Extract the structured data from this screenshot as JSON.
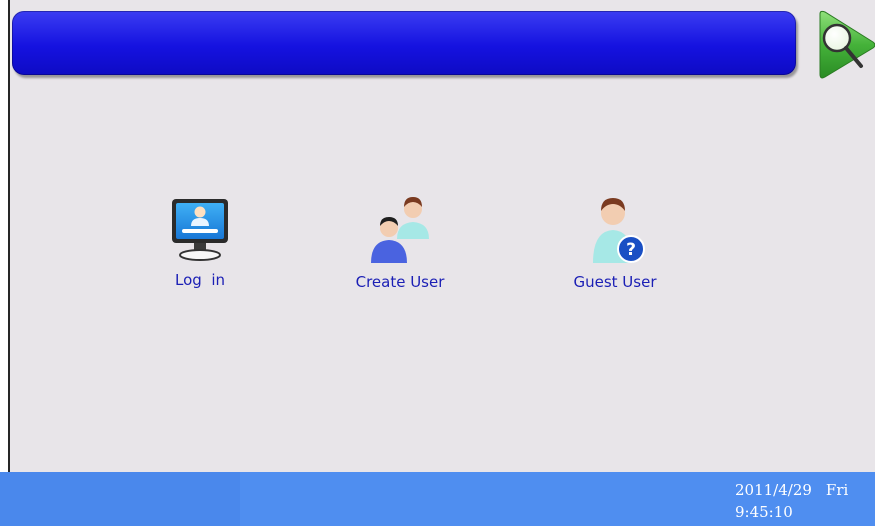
{
  "header": {
    "title": ""
  },
  "nav": {
    "icon": "search-icon"
  },
  "menu": {
    "items": [
      {
        "id": "login",
        "label": "Log  in",
        "icon": "monitor-user-icon"
      },
      {
        "id": "create",
        "label": "Create User",
        "icon": "users-add-icon"
      },
      {
        "id": "guest",
        "label": "Guest User",
        "icon": "guest-user-icon"
      }
    ]
  },
  "status": {
    "date": "2011/4/29",
    "weekday": "Fri",
    "time": "9:45:10"
  },
  "colors": {
    "title_bar": "#1512e0",
    "background": "#e8e5e9",
    "status_bar": "#4f8ef0",
    "label": "#1b1fb5",
    "nav_arrow": "#45b23a"
  }
}
